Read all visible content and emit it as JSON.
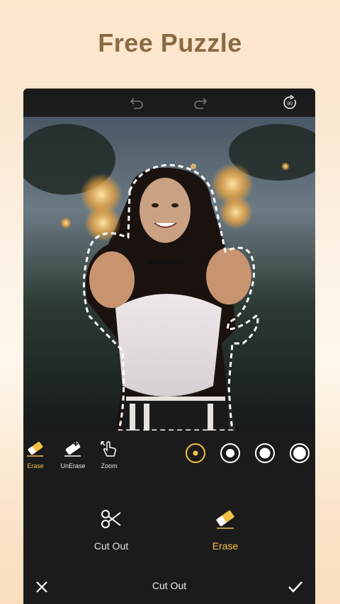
{
  "headline": "Free Puzzle",
  "toolbar": {
    "undo_icon": "undo-icon",
    "redo_icon": "redo-icon",
    "rotate_icon": "rotate-90-icon",
    "rotate_label": "90"
  },
  "brush_tools": [
    {
      "label": "Erase",
      "icon": "eraser-icon",
      "active": true
    },
    {
      "label": "UnErase",
      "icon": "eraser-plus-icon",
      "active": false
    },
    {
      "label": "Zoom",
      "icon": "hand-pointer-icon",
      "active": false
    }
  ],
  "brush_sizes": {
    "count": 4,
    "selected_index": 0
  },
  "modes": [
    {
      "label": "Cut Out",
      "icon": "scissors-icon",
      "active": false
    },
    {
      "label": "Erase",
      "icon": "eraser-icon",
      "active": true
    }
  ],
  "bottom_bar": {
    "title": "Cut Out",
    "cancel_icon": "close-icon",
    "confirm_icon": "check-icon"
  },
  "colors": {
    "accent": "#f2c144",
    "background": "#1b1b1b",
    "headline": "#8a6a45"
  }
}
